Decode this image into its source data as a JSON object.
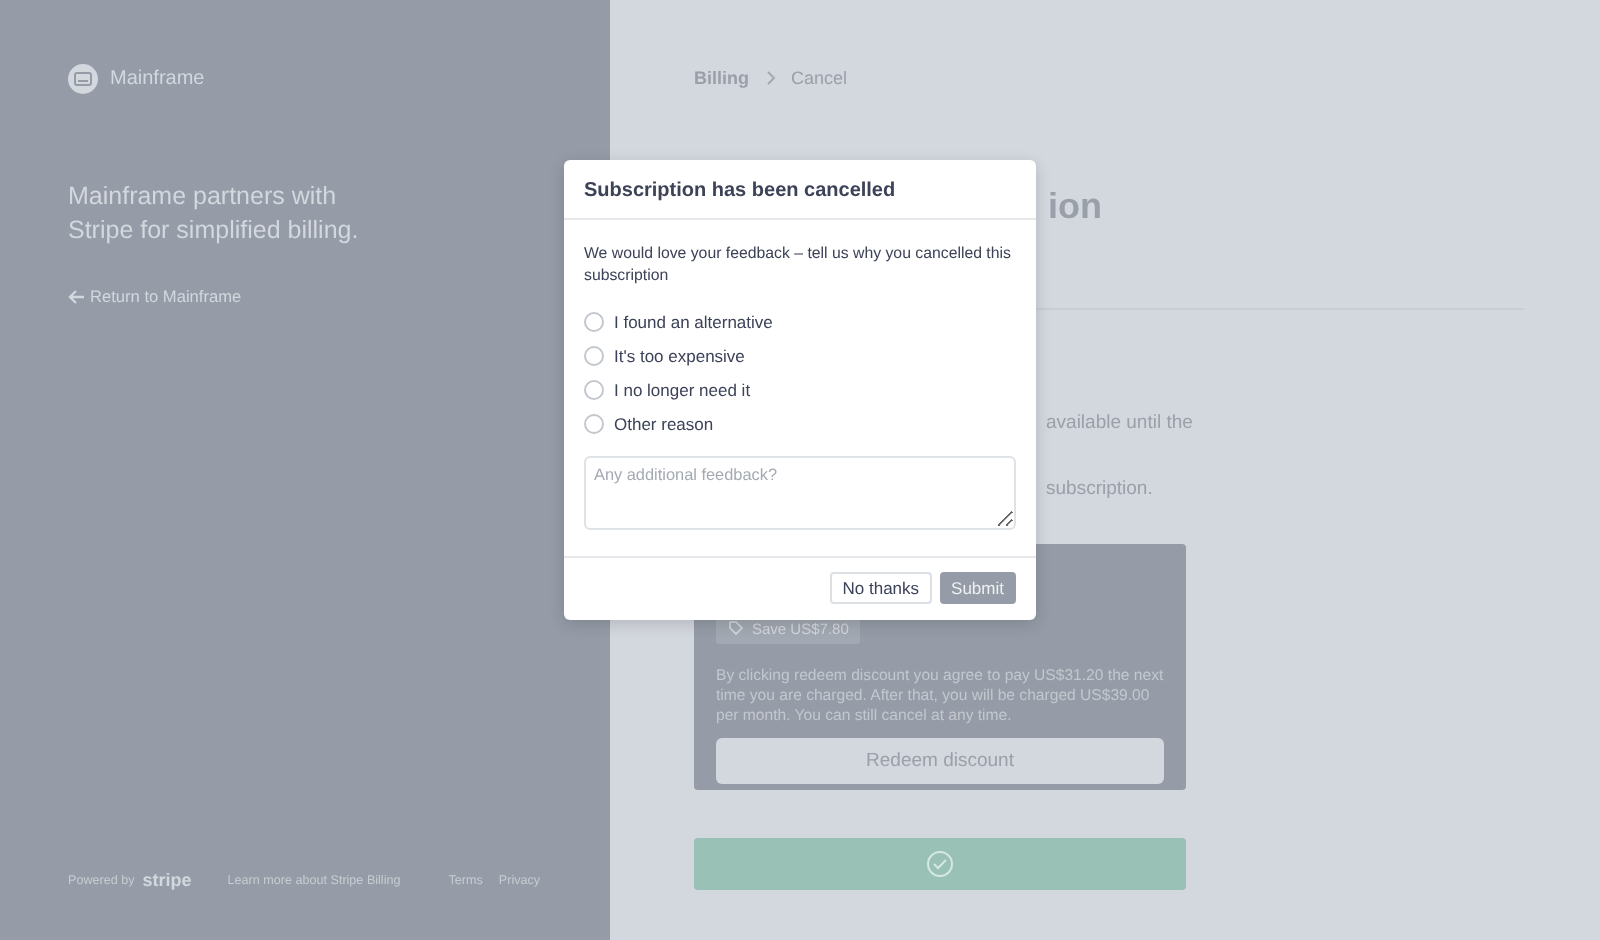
{
  "sidebar": {
    "brand": "Mainframe",
    "tagline": "Mainframe partners with Stripe for simplified billing.",
    "return_link": "Return to Mainframe",
    "footer": {
      "powered_by": "Powered by",
      "stripe_logo": "stripe",
      "learn_more": "Learn more about Stripe Billing",
      "links": [
        "Terms",
        "Privacy"
      ]
    }
  },
  "breadcrumb": [
    "Billing",
    "Cancel"
  ],
  "page": {
    "heading_visible": "ion",
    "lines_visible": [
      "available until the",
      "subscription."
    ],
    "offer": {
      "badge": "Save US$7.80",
      "note": "By clicking redeem discount you agree to pay US$31.20 the next time you are charged. After that, you will be charged US$39.00 per month. You can still cancel at any time.",
      "redeem_button": "Redeem discount"
    }
  },
  "dialog": {
    "title": "Subscription has been cancelled",
    "prompt": "We would love your feedback – tell us why you cancelled this subscription",
    "reasons": [
      {
        "label": "I found an alternative",
        "selected": false
      },
      {
        "label": "It's too expensive",
        "selected": false
      },
      {
        "label": "I no longer need it",
        "selected": false
      },
      {
        "label": "Other reason",
        "selected": false
      }
    ],
    "feedback": {
      "placeholder": "Any additional feedback?"
    },
    "buttons": [
      {
        "label": "No thanks",
        "kind": "secondary"
      },
      {
        "label": "Submit",
        "kind": "primary"
      }
    ]
  }
}
